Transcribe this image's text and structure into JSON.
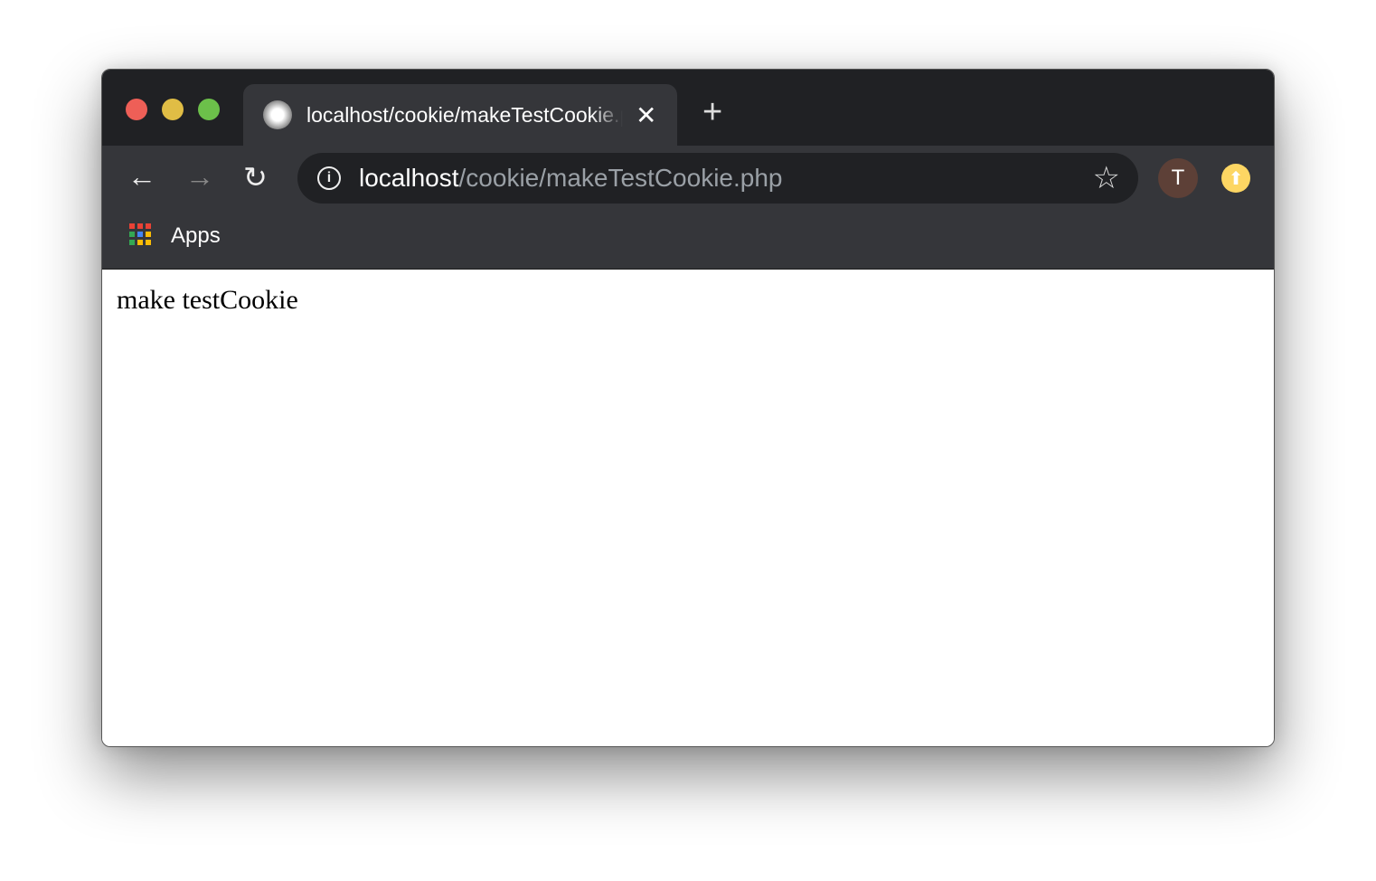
{
  "window": {
    "traffic_lights": {
      "close": "#ee5f57",
      "minimize": "#e0bd45",
      "maximize": "#6cc04a"
    }
  },
  "tab": {
    "title": "localhost/cookie/makeTestCookie.php",
    "close_icon": "close-icon",
    "favicon": "page-favicon"
  },
  "newtab": {
    "label": "+"
  },
  "toolbar": {
    "back": "←",
    "forward": "→",
    "reload": "↻",
    "url_host": "localhost",
    "url_path": "/cookie/makeTestCookie.php",
    "info": "i",
    "star": "☆",
    "avatar_letter": "T",
    "update_icon": "⬆"
  },
  "bookmarks": {
    "apps_label": "Apps",
    "apps_colors": [
      "#e94235",
      "#e94235",
      "#e94235",
      "#34a853",
      "#4285f4",
      "#fbbc05",
      "#34a853",
      "#fbbc05",
      "#fbbc05"
    ]
  },
  "page": {
    "text": "make testCookie"
  }
}
